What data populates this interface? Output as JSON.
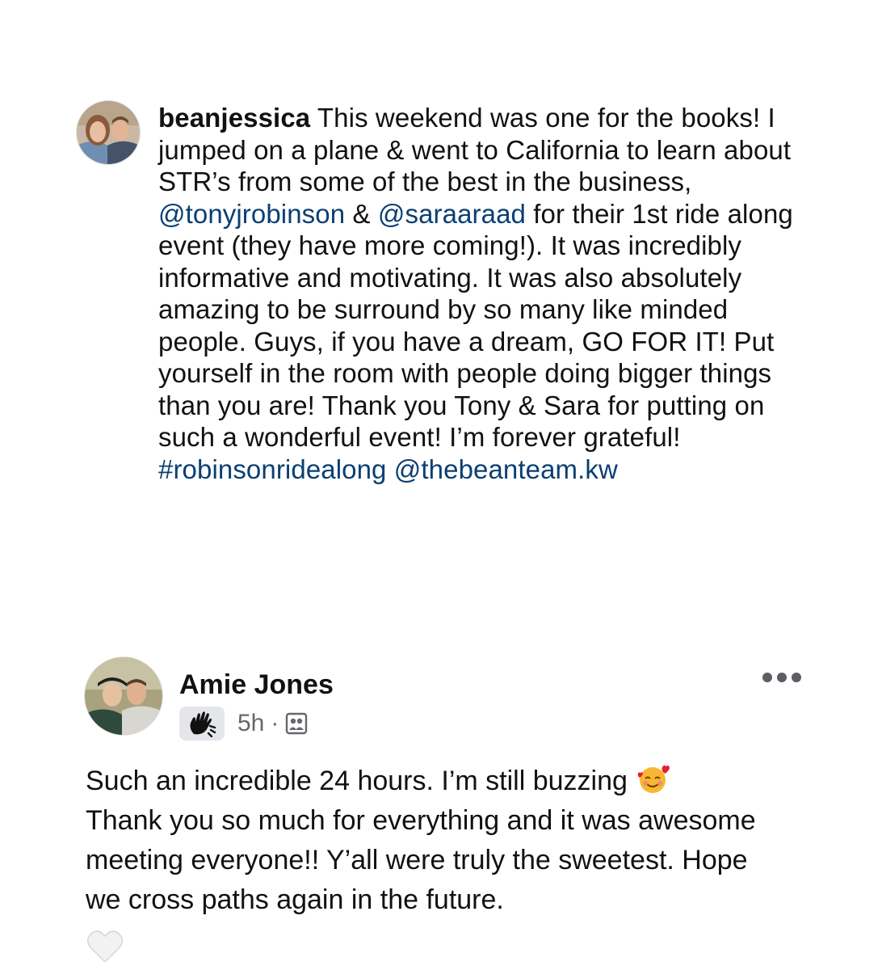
{
  "instagram_post": {
    "username": "beanjessica",
    "caption": {
      "part1": "This weekend was one for the books! I jumped on a plane & went to California to learn about STR’s from some of the best in the business,",
      "mention1": "@tonyjrobinson",
      "amp": "&",
      "mention2": "@saraaraad",
      "part2": "for their 1st ride along event (they have more coming!). It was incredibly informative and motivating. It was also absolutely amazing to be surround by so many like minded people. Guys, if you have a dream, GO FOR IT! Put yourself in the room with people doing bigger things than you are! Thank you Tony & Sara for putting on such a wonderful event! I’m forever grateful!",
      "hashtag": "#robinsonridealong",
      "mention3": "@thebeanteam.kw"
    },
    "link_color": "#0b3f73"
  },
  "facebook_comment": {
    "author": "Amie Jones",
    "time": "5h",
    "separator": "·",
    "badge_icon": "wave-hand-icon",
    "audience_icon": "friends-audience-icon",
    "text": "Such an incredible 24 hours. I’m still buzzing",
    "text_emoji": "smiling-face-with-hearts",
    "text2": "Thank you so much for everything and it was awesome meeting everyone!! Y’all were truly the sweetest. Hope we cross paths again in the future.",
    "trailing_emoji": "white-heart"
  }
}
